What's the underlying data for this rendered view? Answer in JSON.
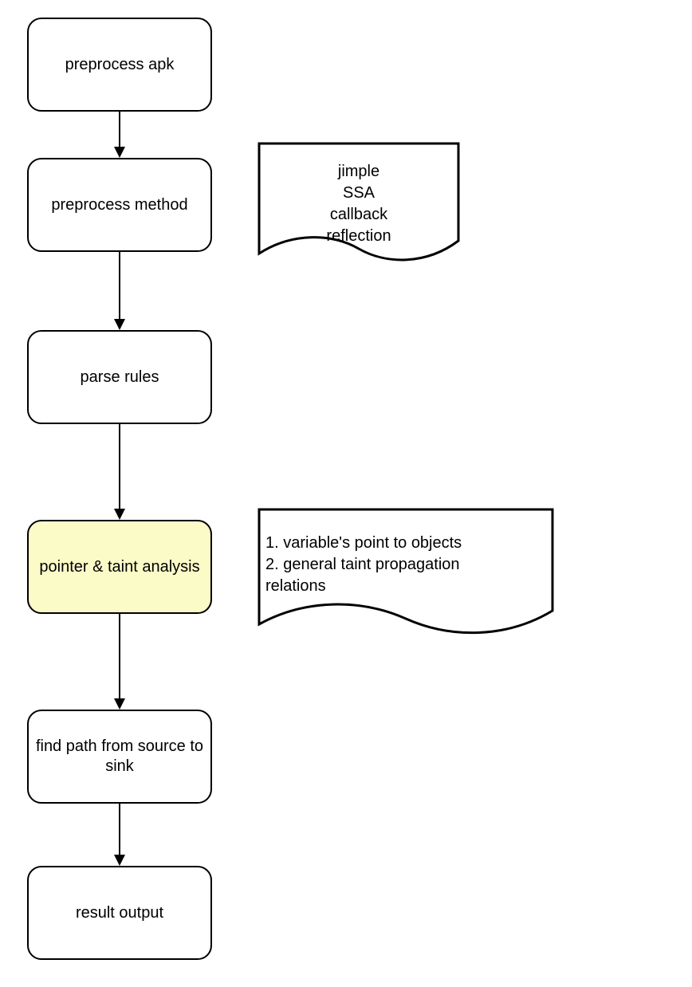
{
  "nodes": {
    "preprocess_apk": "preprocess apk",
    "preprocess_method": "preprocess method",
    "parse_rules": "parse rules",
    "pointer_taint": "pointer & taint analysis",
    "find_path": "find path from source to sink",
    "result_output": "result output"
  },
  "annotations": {
    "anno1_line1": "jimple",
    "anno1_line2": "SSA",
    "anno1_line3": "callback",
    "anno1_line4": "reflection",
    "anno2_line1": "1. variable's point to objects",
    "anno2_line2": "2. general taint propagation",
    "anno2_line3": "relations"
  },
  "colors": {
    "highlight_bg": "#fbfbc8"
  }
}
